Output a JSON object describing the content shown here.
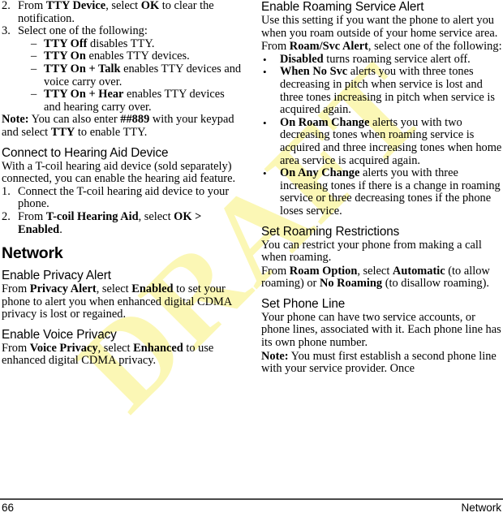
{
  "watermark": {
    "text": "DRAFT",
    "color": "#fbf7b5"
  },
  "footer": {
    "page_number": "66",
    "section": "Network"
  },
  "left_column": {
    "steps_tty": [
      {
        "marker": "2.",
        "segments": [
          {
            "text": "From ",
            "bold": false
          },
          {
            "text": "TTY Device",
            "bold": true
          },
          {
            "text": ", select ",
            "bold": false
          },
          {
            "text": "OK",
            "bold": true
          },
          {
            "text": " to clear the notification.",
            "bold": false
          }
        ]
      },
      {
        "marker": "3.",
        "segments": [
          {
            "text": "Select one of the following:",
            "bold": false
          }
        ]
      }
    ],
    "tty_options": [
      {
        "marker": "–",
        "segments": [
          {
            "text": "TTY Off",
            "bold": true
          },
          {
            "text": " disables TTY.",
            "bold": false
          }
        ]
      },
      {
        "marker": "–",
        "segments": [
          {
            "text": "TTY On",
            "bold": true
          },
          {
            "text": " enables TTY devices.",
            "bold": false
          }
        ]
      },
      {
        "marker": "–",
        "segments": [
          {
            "text": "TTY On + Talk",
            "bold": true
          },
          {
            "text": " enables TTY devices and voice carry over.",
            "bold": false
          }
        ]
      },
      {
        "marker": "–",
        "segments": [
          {
            "text": "TTY On + Hear",
            "bold": true
          },
          {
            "text": " enables TTY devices and hearing carry over.",
            "bold": false
          }
        ]
      }
    ],
    "tty_note": [
      {
        "text": "Note:",
        "bold": true
      },
      {
        "text": " You can also enter ",
        "bold": false
      },
      {
        "text": "##889",
        "bold": true
      },
      {
        "text": " with your keypad and select ",
        "bold": false
      },
      {
        "text": "TTY",
        "bold": true
      },
      {
        "text": " to enable TTY.",
        "bold": false
      }
    ],
    "hearing_aid_heading": "Connect to Hearing Aid Device",
    "hearing_aid_intro": [
      {
        "text": "With a T-coil hearing aid device (sold separately) connected, you can enable the hearing aid feature.",
        "bold": false
      }
    ],
    "hearing_aid_steps": [
      {
        "marker": "1.",
        "segments": [
          {
            "text": "Connect the T-coil hearing aid device to your phone.",
            "bold": false
          }
        ]
      },
      {
        "marker": "2.",
        "segments": [
          {
            "text": "From ",
            "bold": false
          },
          {
            "text": "T-coil Hearing Aid",
            "bold": true
          },
          {
            "text": ", select ",
            "bold": false
          },
          {
            "text": "OK > Enabled",
            "bold": true
          },
          {
            "text": ".",
            "bold": false
          }
        ]
      }
    ],
    "network_heading": "Network",
    "privacy_alert_heading": "Enable Privacy Alert",
    "privacy_alert_body": [
      {
        "text": "From ",
        "bold": false
      },
      {
        "text": "Privacy Alert",
        "bold": true
      },
      {
        "text": ", select ",
        "bold": false
      },
      {
        "text": "Enabled",
        "bold": true
      },
      {
        "text": " to set your phone to alert you when enhanced digital CDMA privacy is lost or regained.",
        "bold": false
      }
    ],
    "voice_privacy_heading": "Enable Voice Privacy",
    "voice_privacy_body": [
      {
        "text": "From ",
        "bold": false
      },
      {
        "text": "Voice Privacy",
        "bold": true
      },
      {
        "text": ", select ",
        "bold": false
      },
      {
        "text": "Enhanced",
        "bold": true
      },
      {
        "text": " to use enhanced digital CDMA privacy.",
        "bold": false
      }
    ]
  },
  "right_column": {
    "roaming_alert_heading": "Enable Roaming Service Alert",
    "roaming_alert_intro": [
      {
        "text": "Use this setting if you want the phone to alert you when you roam outside of your home service area.",
        "bold": false
      }
    ],
    "roaming_alert_lead": [
      {
        "text": "From ",
        "bold": false
      },
      {
        "text": "Roam/Svc Alert",
        "bold": true
      },
      {
        "text": ", select one of the following:",
        "bold": false
      }
    ],
    "roaming_alert_options": [
      {
        "marker": "•",
        "segments": [
          {
            "text": "Disabled",
            "bold": true
          },
          {
            "text": " turns roaming service alert off.",
            "bold": false
          }
        ]
      },
      {
        "marker": "•",
        "segments": [
          {
            "text": "When No Svc",
            "bold": true
          },
          {
            "text": " alerts you with three tones decreasing in pitch when service is lost and three tones increasing in pitch when service is acquired again.",
            "bold": false
          }
        ]
      },
      {
        "marker": "•",
        "segments": [
          {
            "text": "On Roam Change",
            "bold": true
          },
          {
            "text": " alerts you with two decreasing tones when roaming service is acquired and three increasing tones when home area service is acquired again.",
            "bold": false
          }
        ]
      },
      {
        "marker": "•",
        "segments": [
          {
            "text": "On Any Change",
            "bold": true
          },
          {
            "text": " alerts you with three increasing tones if there is a change in roaming service or three decreasing tones if the phone loses service.",
            "bold": false
          }
        ]
      }
    ],
    "roaming_restrictions_heading": "Set Roaming Restrictions",
    "roaming_restrictions_intro": [
      {
        "text": "You can restrict your phone from making a call when roaming.",
        "bold": false
      }
    ],
    "roaming_restrictions_body": [
      {
        "text": "From ",
        "bold": false
      },
      {
        "text": "Roam Option",
        "bold": true
      },
      {
        "text": ", select ",
        "bold": false
      },
      {
        "text": "Automatic",
        "bold": true
      },
      {
        "text": " (to allow roaming) or ",
        "bold": false
      },
      {
        "text": "No Roaming",
        "bold": true
      },
      {
        "text": " (to disallow roaming).",
        "bold": false
      }
    ],
    "phone_line_heading": "Set Phone Line",
    "phone_line_intro": [
      {
        "text": "Your phone can have two service accounts, or phone lines, associated with it. Each phone line has its own phone number.",
        "bold": false
      }
    ],
    "phone_line_note": [
      {
        "text": "Note:",
        "bold": true
      },
      {
        "text": " You must first establish a second phone line with your service provider. Once",
        "bold": false
      }
    ]
  }
}
